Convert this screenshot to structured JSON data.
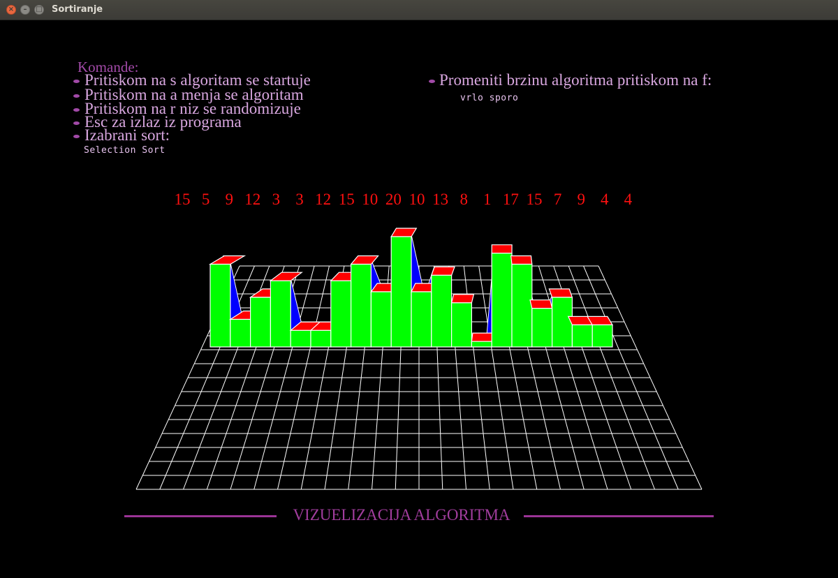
{
  "window": {
    "title": "Sortiranje"
  },
  "commands": {
    "heading": "Komande:",
    "items": [
      "Pritiskom na s algoritam se startuje",
      "Pritiskom na a menja se algoritam",
      "Pritiskom na r niz se randomizuje",
      "Esc za izlaz iz programa",
      "Izabrani sort:"
    ],
    "selected_sort": "Selection Sort",
    "speed_label": "Promeniti brzinu algoritma pritiskom na f:",
    "speed_value": "vrlo sporo"
  },
  "array": {
    "values": [
      15,
      5,
      9,
      12,
      3,
      3,
      12,
      15,
      10,
      20,
      10,
      13,
      8,
      1,
      17,
      15,
      7,
      9,
      4,
      4
    ]
  },
  "footer": {
    "title": "VIZUELIZACIJA ALGORITMA"
  },
  "colors": {
    "bar_front": "#00ff00",
    "bar_top": "#ff0000",
    "bar_side": "#0000ff",
    "grid": "#ffffff",
    "accent": "#a24aa8"
  }
}
